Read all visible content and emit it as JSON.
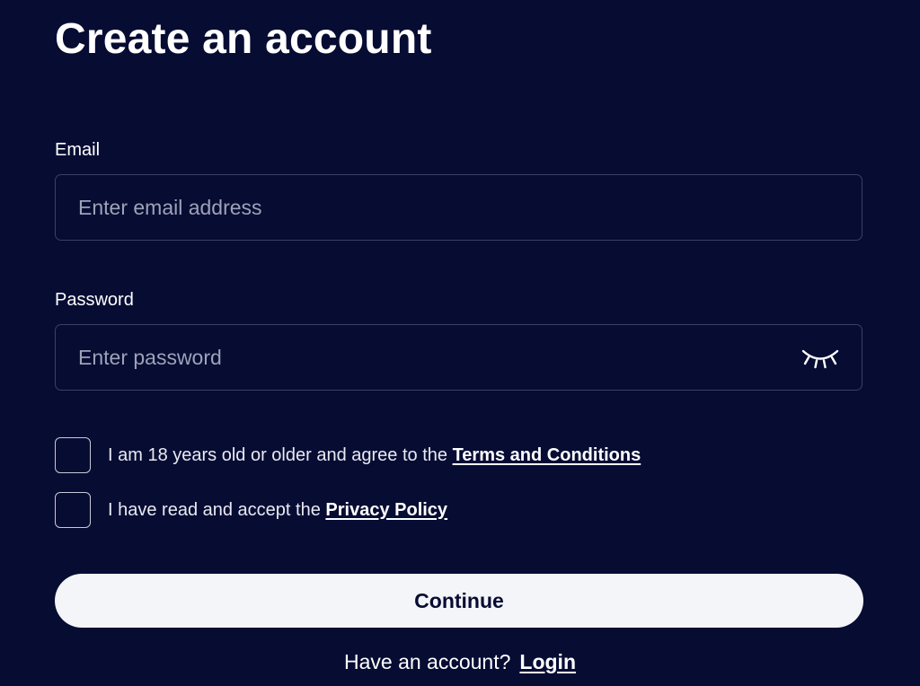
{
  "page": {
    "title": "Create an account"
  },
  "email": {
    "label": "Email",
    "value": "",
    "placeholder": "Enter email address"
  },
  "password": {
    "label": "Password",
    "value": "",
    "placeholder": "Enter password",
    "toggle_icon": "eye-closed-icon"
  },
  "agreements": {
    "terms": {
      "checked": false,
      "text": "I am 18 years old or older and agree to the ",
      "link": "Terms and Conditions"
    },
    "privacy": {
      "checked": false,
      "text": "I have read and accept the ",
      "link": "Privacy Policy"
    }
  },
  "actions": {
    "continue_label": "Continue"
  },
  "login": {
    "prompt": "Have an account?",
    "link": "Login"
  },
  "colors": {
    "background": "#070c33",
    "text": "#ffffff",
    "border": "#3b4164",
    "placeholder": "#9ea2b8",
    "button_bg": "#f4f5f8",
    "button_text": "#070c33"
  }
}
